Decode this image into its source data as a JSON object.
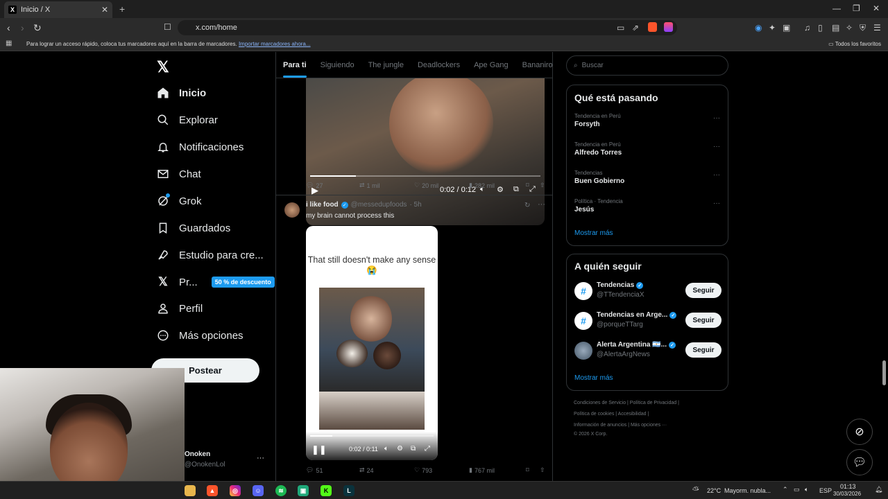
{
  "browser": {
    "tab_title": "Inicio / X",
    "tab_close": "✕",
    "new_tab": "+",
    "url": "x.com/home",
    "bookmarks_message": "Para lograr un acceso rápido, coloca tus marcadores aquí en la barra de marcadores.",
    "bookmarks_import_link": "Importar marcadores ahora...",
    "bookmarks_all": "Todos los favoritos"
  },
  "sidebar": {
    "logo": "𝕏",
    "items": [
      {
        "label": "Inicio",
        "icon": "home-icon"
      },
      {
        "label": "Explorar",
        "icon": "search-icon"
      },
      {
        "label": "Notificaciones",
        "icon": "bell-icon"
      },
      {
        "label": "Chat",
        "icon": "mail-icon"
      },
      {
        "label": "Grok",
        "icon": "grok-icon"
      },
      {
        "label": "Guardados",
        "icon": "bookmark-icon"
      },
      {
        "label": "Estudio para cre...",
        "icon": "rocket-icon"
      },
      {
        "label": "Pr...",
        "icon": "x-premium-icon",
        "badge": "50 % de descuento"
      },
      {
        "label": "Perfil",
        "icon": "person-icon"
      },
      {
        "label": "Más opciones",
        "icon": "more-circle-icon"
      }
    ],
    "post_button": "Postear",
    "account_name": "Onoken",
    "account_handle": "@OnokenLol",
    "account_menu": "···"
  },
  "feed": {
    "tabs": [
      "Para ti",
      "Siguiendo",
      "The jungle",
      "Deadlockers",
      "Ape Gang",
      "Bananirou"
    ],
    "tweet1": {
      "video_time": "0:02 / 0:12",
      "video_progress": 0.2,
      "replies": "27",
      "reposts": "1 mil",
      "likes": "20 mil",
      "views": "282 mil"
    },
    "tweet2": {
      "author": "i like food",
      "handle": "@messedupfoods",
      "time": "· 5h",
      "text": "my brain cannot process this",
      "media_caption": "That still doesn't make any sense 😭",
      "video_time": "0:02 / 0:11",
      "video_progress": 0.18,
      "replies": "51",
      "reposts": "24",
      "likes": "793",
      "views": "767 mil"
    }
  },
  "right": {
    "search_placeholder": "Buscar",
    "trends_title": "Qué está pasando",
    "trends": [
      {
        "context": "Tendencia en Perú",
        "name": "Forsyth"
      },
      {
        "context": "Tendencia en Perú",
        "name": "Alfredo Torres"
      },
      {
        "context": "Tendencias",
        "name": "Buen Gobierno"
      },
      {
        "context": "Política · Tendencia",
        "name": "Jesús"
      }
    ],
    "show_more": "Mostrar más",
    "follow_title": "A quién seguir",
    "follow": [
      {
        "name": "Tendencias",
        "handle": "@TTendenciaX",
        "button": "Seguir"
      },
      {
        "name": "Tendencias en Arge...",
        "handle": "@porqueTTarg",
        "button": "Seguir"
      },
      {
        "name": "Alerta Argentina 🇦🇷...",
        "handle": "@AlertaArgNews",
        "button": "Seguir"
      }
    ],
    "show_more2": "Mostrar más",
    "footer_lines": [
      "Condiciones de Servicio  |  Política de Privacidad  |",
      "Política de cookies  |  Accesibilidad  |",
      "Información de anuncios  |  Más opciones ···",
      "© 2026 X Corp."
    ]
  },
  "taskbar": {
    "weather": "22°C",
    "weather_desc": "Mayorm. nubla...",
    "lang": "ESP",
    "time": "01:13",
    "date": "30/03/2026"
  }
}
